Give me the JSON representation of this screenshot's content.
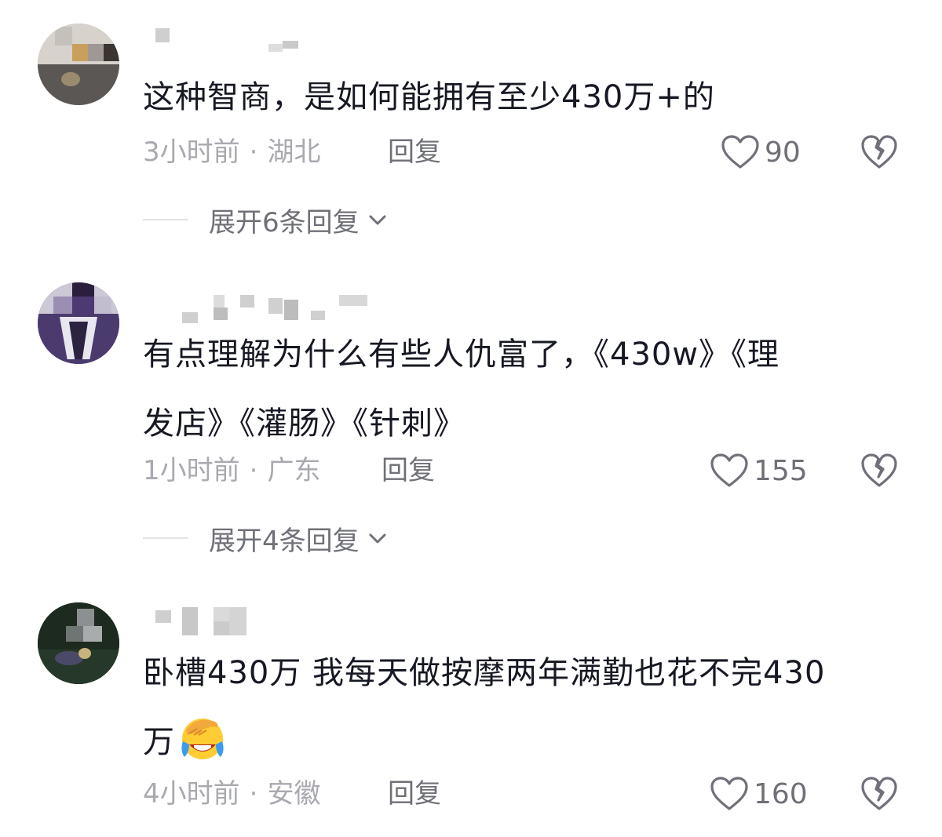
{
  "comments": [
    {
      "text": "这种智商，是如何能拥有至少430万+的",
      "time": "3小时前",
      "location": "湖北",
      "reply_label": "回复",
      "likes": "90",
      "expand_label": "展开6条回复"
    },
    {
      "text_line1": "有点理解为什么有些人仇富了，《430w》《理",
      "text_line2": "发店》《灌肠》《针刺》",
      "time": "1小时前",
      "location": "广东",
      "reply_label": "回复",
      "likes": "155",
      "expand_label": "展开4条回复"
    },
    {
      "text_line1": "卧槽430万 我每天做按摩两年满勤也花不完430",
      "text_line2": "万",
      "emoji": "face-with-hand-over-eyes-crying-emoji",
      "time": "4小时前",
      "location": "安徽",
      "reply_label": "回复",
      "likes": "160"
    }
  ],
  "separator": "·",
  "colors": {
    "text": "#161823",
    "meta": "#a9aab0",
    "action": "#6f7078",
    "divider": "#e3e3e5"
  }
}
